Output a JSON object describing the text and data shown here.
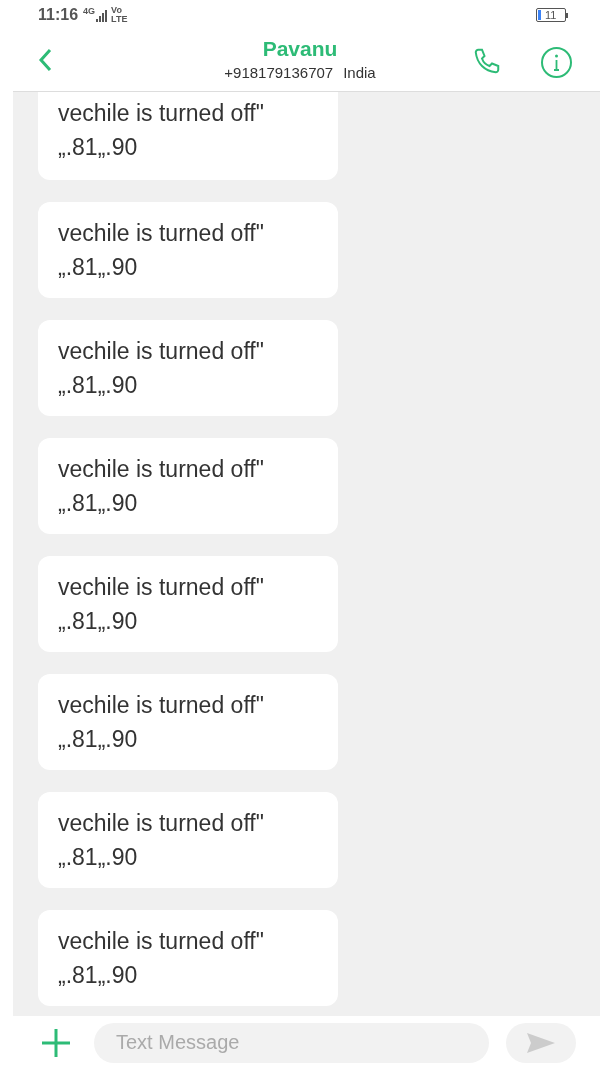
{
  "status_bar": {
    "time": "11:16",
    "network": "4G",
    "volte": "Vo LTE",
    "battery": "11"
  },
  "header": {
    "name": "Pavanu",
    "number": "+918179136707",
    "country": "India"
  },
  "messages": [
    {
      "text": "vechile is turned off\"\n„.81„.90"
    },
    {
      "text": "vechile is turned off\"\n„.81„.90"
    },
    {
      "text": "vechile is turned off\"\n„.81„.90"
    },
    {
      "text": "vechile is turned off\"\n„.81„.90"
    },
    {
      "text": "vechile is turned off\"\n„.81„.90"
    },
    {
      "text": "vechile is turned off\"\n„.81„.90"
    },
    {
      "text": "vechile is turned off\"\n„.81„.90"
    },
    {
      "text": "vechile is turned off\"\n„.81„.90"
    }
  ],
  "composer": {
    "placeholder": "Text Message"
  }
}
